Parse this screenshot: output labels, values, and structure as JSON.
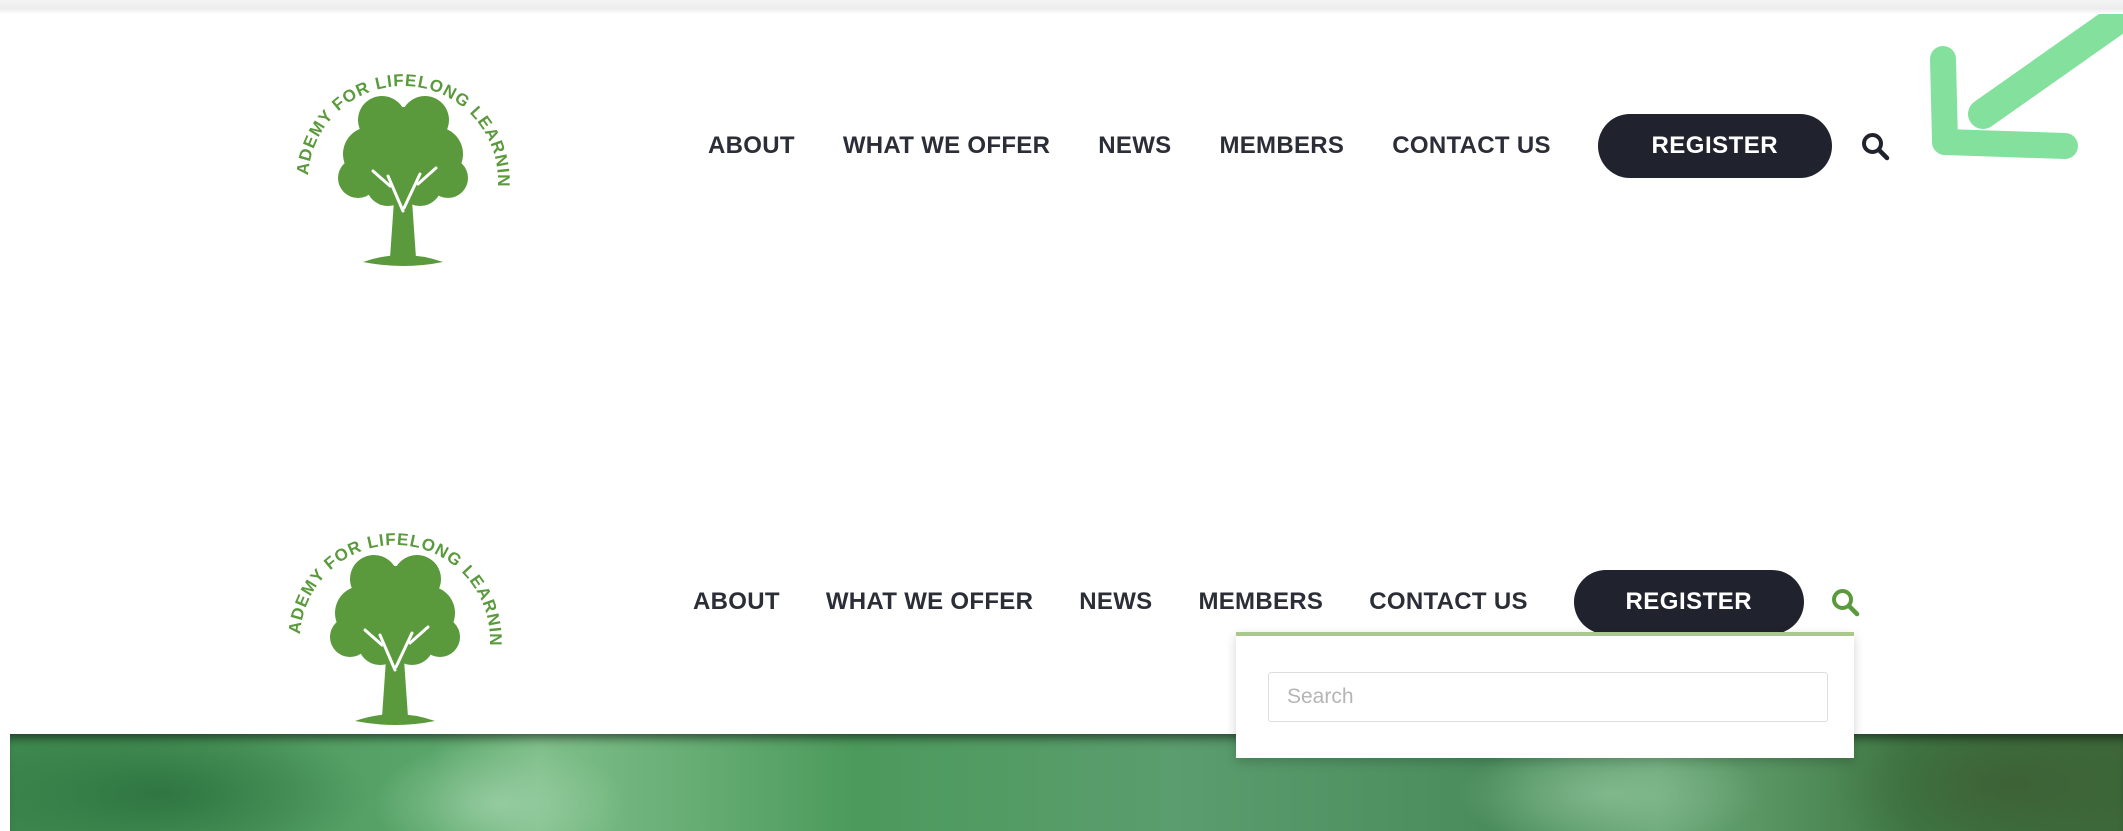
{
  "logo": {
    "text": "ACADEMY FOR LIFELONG LEARNING",
    "color": "#5a9a3c"
  },
  "nav": {
    "items": [
      {
        "label": "ABOUT"
      },
      {
        "label": "WHAT WE OFFER"
      },
      {
        "label": "NEWS"
      },
      {
        "label": "MEMBERS"
      },
      {
        "label": "CONTACT US"
      }
    ],
    "register_label": "REGISTER"
  },
  "search": {
    "icon": "search-icon",
    "placeholder": "Search",
    "value": ""
  },
  "colors": {
    "nav_text": "#2b2e37",
    "button_bg": "#20232e",
    "button_text": "#ffffff",
    "search_icon_active": "#5a9a3c",
    "annotation_arrow": "#6fdc8c"
  }
}
